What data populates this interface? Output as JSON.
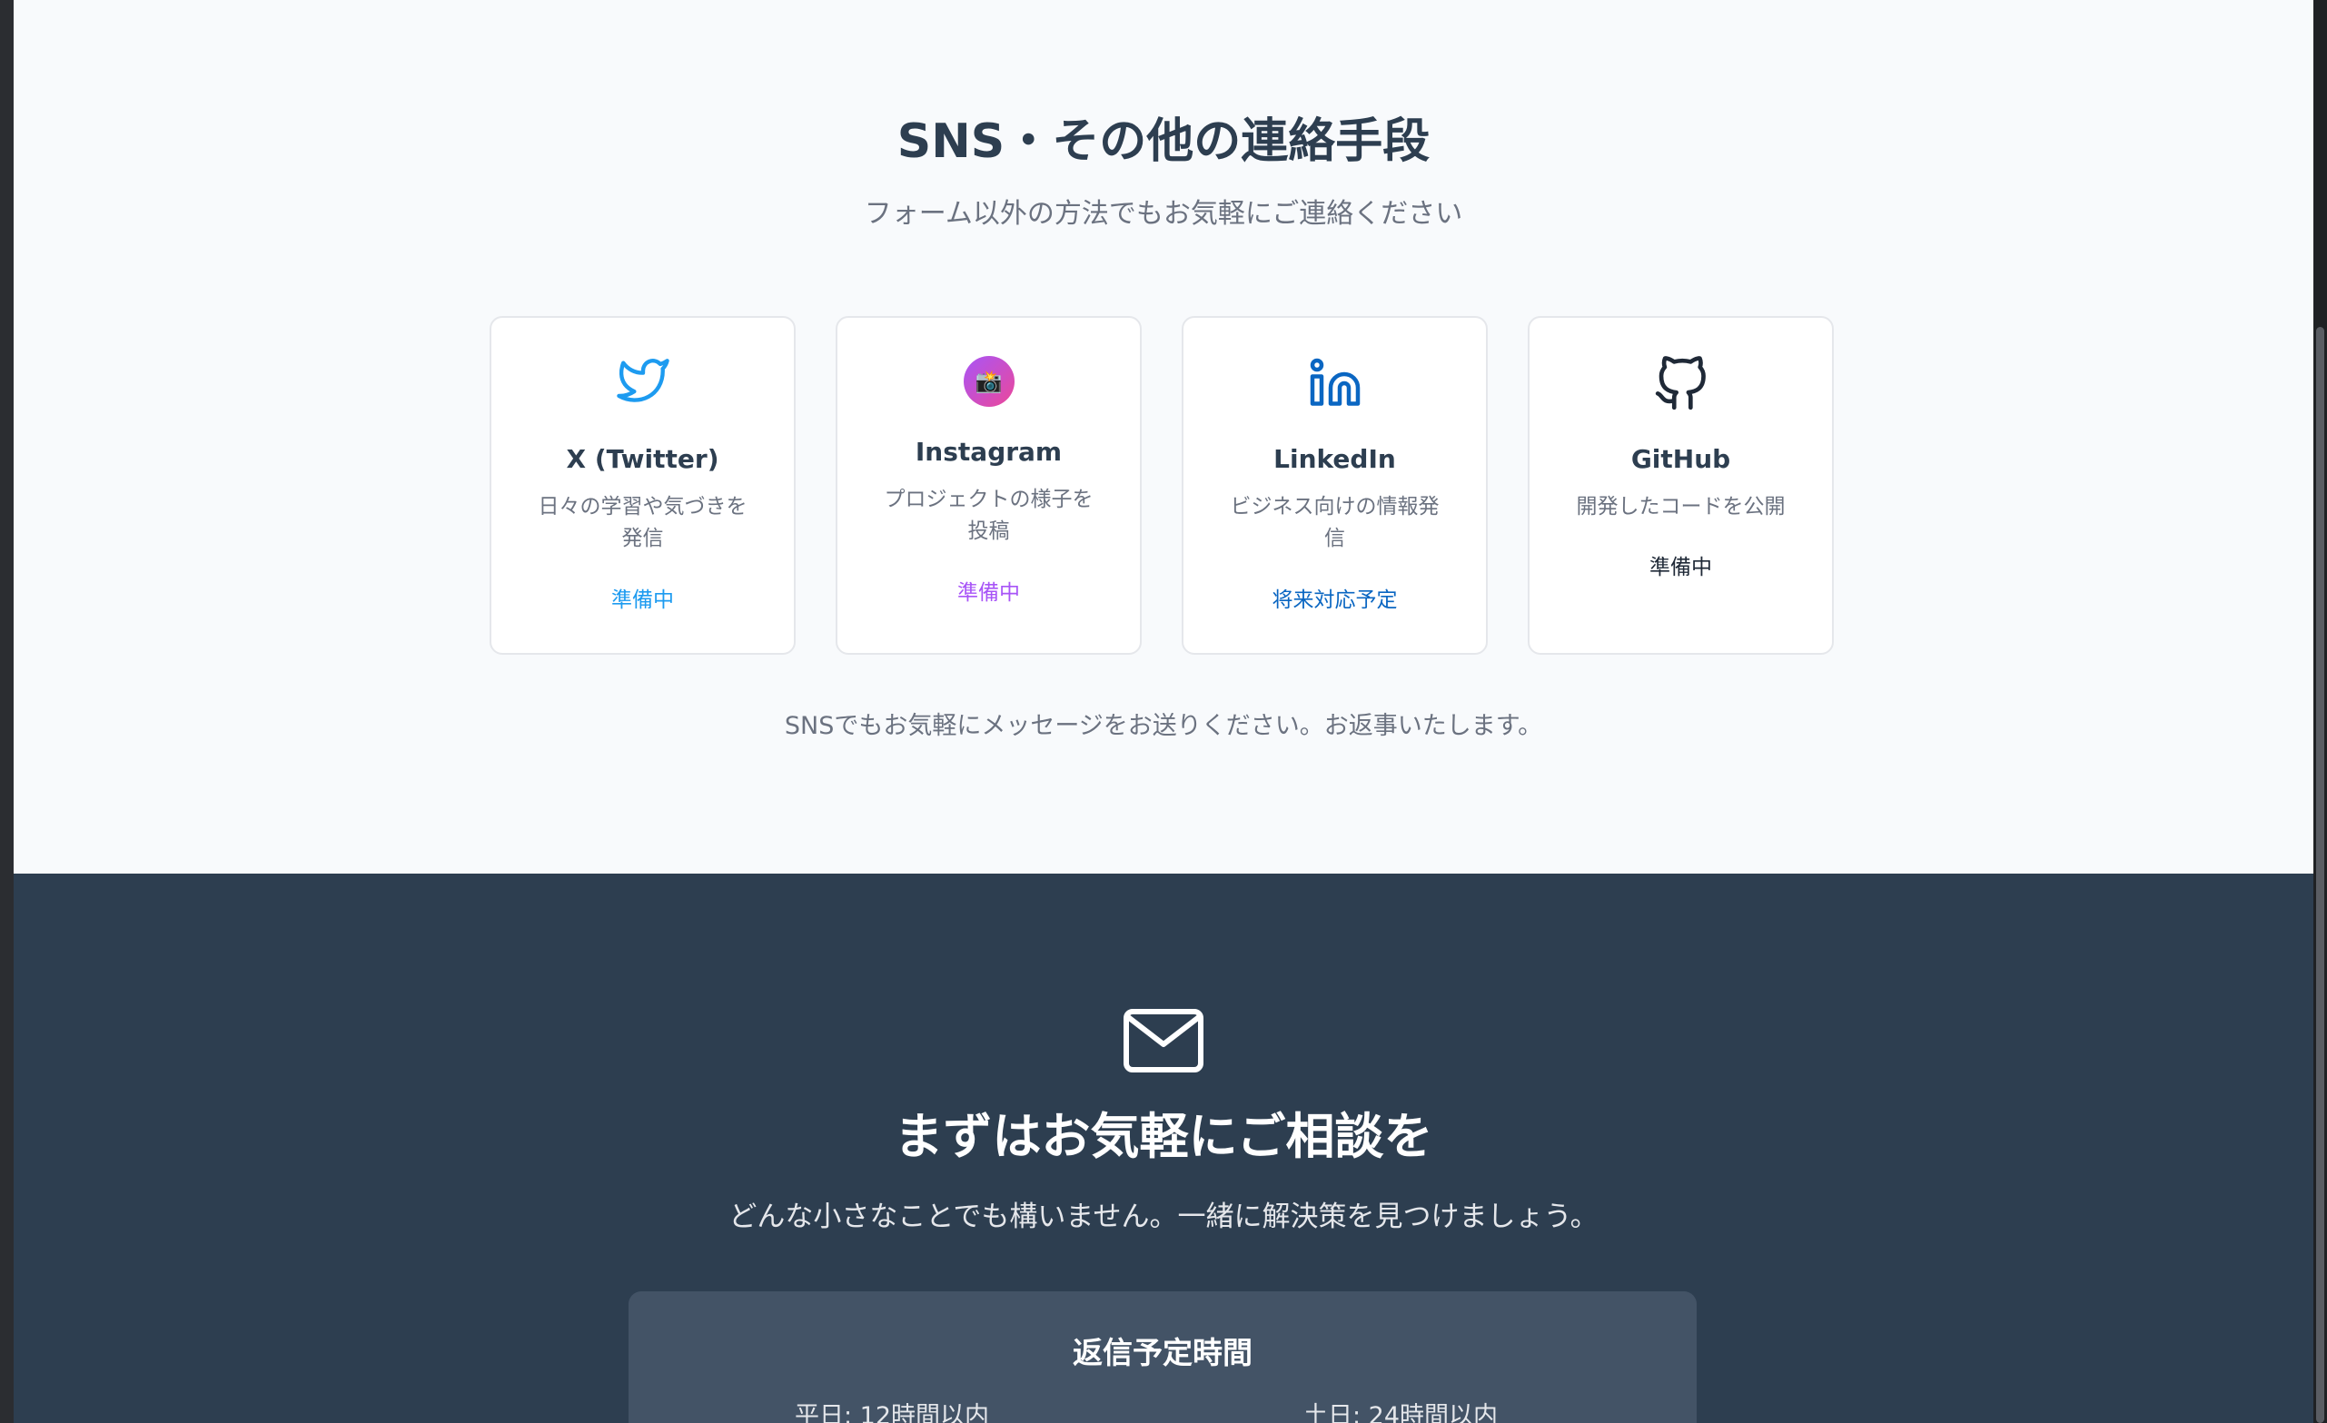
{
  "sns": {
    "title": "SNS・その他の連絡手段",
    "subtitle": "フォーム以外の方法でもお気軽にご連絡ください",
    "cards": [
      {
        "icon": "twitter-bird-icon",
        "name": "X (Twitter)",
        "desc_line1": "日々の学習や気づきを",
        "desc_line2": "発信",
        "status": "準備中",
        "status_color": "#1d9bf0"
      },
      {
        "icon": "camera-icon",
        "glyph": "📸",
        "name": "Instagram",
        "desc_line1": "プロジェクトの様子を",
        "desc_line2": "投稿",
        "status": "準備中",
        "status_color": "#a855f7"
      },
      {
        "icon": "linkedin-icon",
        "name": "LinkedIn",
        "desc_line1": "ビジネス向けの情報発",
        "desc_line2": "信",
        "status": "将来対応予定",
        "status_color": "#0a66c2"
      },
      {
        "icon": "github-icon",
        "name": "GitHub",
        "desc_line1": "開発したコードを公開",
        "status": "準備中",
        "status_color": "#1f2937"
      }
    ],
    "note": "SNSでもお気軽にメッセージをお送りください。お返事いたします。"
  },
  "cta": {
    "icon": "mail-icon",
    "title": "まずはお気軽にご相談を",
    "text": "どんな小さなことでも構いません。一緒に解決策を見つけましょう。",
    "reply_box": {
      "title": "返信予定時間",
      "weekday": "平日: 12時間以内",
      "weekend": "土日: 24時間以内"
    }
  },
  "colors": {
    "page_bg": "#f8fafc",
    "heading": "#2d3e50",
    "cta_bg": "#2d3e50",
    "reply_box_bg": "#435366",
    "twitter": "#1d9bf0",
    "instagram": "#a855f7",
    "linkedin": "#0a66c2",
    "github": "#1f2937"
  }
}
